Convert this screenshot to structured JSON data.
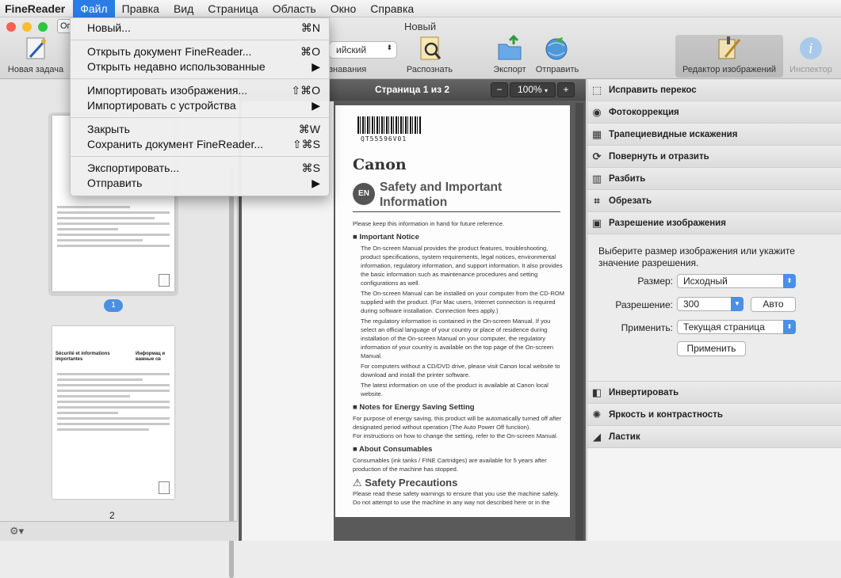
{
  "menubar": {
    "app": "FineReader",
    "items": [
      "Файл",
      "Правка",
      "Вид",
      "Страница",
      "Область",
      "Окно",
      "Справка"
    ]
  },
  "window": {
    "title": "Новый",
    "tab_fragment": "Ог"
  },
  "toolbar": {
    "new_task": "Новая задача",
    "language_value": "ийский",
    "language_label": "знавания",
    "recognize": "Распознать",
    "export": "Экспорт",
    "send": "Отправить",
    "image_editor": "Редактор изображений",
    "inspector": "Инспектор"
  },
  "file_menu": {
    "new": {
      "label": "Новый...",
      "shortcut": "⌘N"
    },
    "open": {
      "label": "Открыть документ FineReader...",
      "shortcut": "⌘O"
    },
    "open_recent": {
      "label": "Открыть недавно использованные",
      "shortcut": "▶"
    },
    "import_images": {
      "label": "Импортировать изображения...",
      "shortcut": "⇧⌘O"
    },
    "import_device": {
      "label": "Импортировать с устройства",
      "shortcut": "▶"
    },
    "close": {
      "label": "Закрыть",
      "shortcut": "⌘W"
    },
    "save": {
      "label": "Сохранить документ FineReader...",
      "shortcut": "⇧⌘S"
    },
    "export": {
      "label": "Экспортировать...",
      "shortcut": "⌘S"
    },
    "send": {
      "label": "Отправить",
      "shortcut": "▶"
    }
  },
  "thumbnails": {
    "page1_badge": "1",
    "page2_label": "2",
    "page2_title": "Sécurité et informations importantes",
    "page2_title2": "Информац и важные св"
  },
  "viewer": {
    "page_title": "Страница 1 из 2",
    "zoom_minus": "−",
    "zoom_value": "100%",
    "zoom_plus": "+"
  },
  "document": {
    "barcode": "QT55596V01",
    "brand": "Canon",
    "badge": "EN",
    "title": "Safety and Important Information",
    "intro": "Please keep this information in hand for future reference.",
    "h_notice": "Important Notice",
    "b1": "The On-screen Manual provides the product features, troubleshooting, product specifications, system requirements, legal notices, environmental information, regulatory information, and support information. It also provides the basic information such as maintenance procedures and setting configurations as well.",
    "b2": "The On-screen Manual can be installed on your computer from the CD-ROM supplied with the product. (For Mac users, Internet connection is required during software installation. Connection fees apply.)",
    "b3": "The regulatory information is contained in the On-screen Manual. If you select an official language of your country or place of residence during installation of the On-screen Manual on your computer, the regulatory information of your country is available on the top page of the On-screen Manual.",
    "b4": "For computers without a CD/DVD drive, please visit Canon local website to download and install the printer software.",
    "b5": "The latest information on use of the product is available at Canon local website.",
    "h_energy": "Notes for Energy Saving Setting",
    "energy1": "For purpose of energy saving, this product will be automatically turned off after designated period without operation (The Auto Power Off function).",
    "energy2": "For instructions on how to change the setting, refer to the On-screen Manual.",
    "h_consumables": "About Consumables",
    "consumables": "Consumables (ink tanks / FINE Cartridges) are available for 5 years after production of the machine has stopped.",
    "h_safety": "Safety Precautions",
    "safety1": "Please read these safety warnings to ensure that you use the machine safely.",
    "safety2": "Do not attempt to use the machine in any way not described here or in the"
  },
  "right_panel": {
    "sections_top": [
      {
        "icon": "skew-icon",
        "glyph": "⬚",
        "label": "Исправить перекос"
      },
      {
        "icon": "camera-icon",
        "glyph": "◉",
        "label": "Фотокоррекция"
      },
      {
        "icon": "trapezoid-icon",
        "glyph": "▦",
        "label": "Трапециевидные искажения"
      },
      {
        "icon": "rotate-icon",
        "glyph": "⟳",
        "label": "Повернуть и отразить"
      },
      {
        "icon": "split-icon",
        "glyph": "▥",
        "label": "Разбить"
      },
      {
        "icon": "crop-icon",
        "glyph": "⌗",
        "label": "Обрезать"
      },
      {
        "icon": "resolution-icon",
        "glyph": "▣",
        "label": "Разрешение изображения"
      }
    ],
    "resolution": {
      "description": "Выберите размер изображения или укажите значение разрешения.",
      "size_label": "Размер:",
      "size_value": "Исходный",
      "res_label": "Разрешение:",
      "res_value": "300",
      "auto_button": "Авто",
      "apply_to_label": "Применить:",
      "apply_to_value": "Текущая страница",
      "apply_button": "Применить"
    },
    "sections_bottom": [
      {
        "icon": "invert-icon",
        "glyph": "◧",
        "label": "Инвертировать"
      },
      {
        "icon": "brightness-icon",
        "glyph": "✺",
        "label": "Яркость и контрастность"
      },
      {
        "icon": "eraser-icon",
        "glyph": "◢",
        "label": "Ластик"
      }
    ]
  },
  "bottom": {
    "settings_glyph": "⚙▾"
  },
  "colors": {
    "accent": "#2c7ce5",
    "select_arrow": "#4a8fe8"
  }
}
